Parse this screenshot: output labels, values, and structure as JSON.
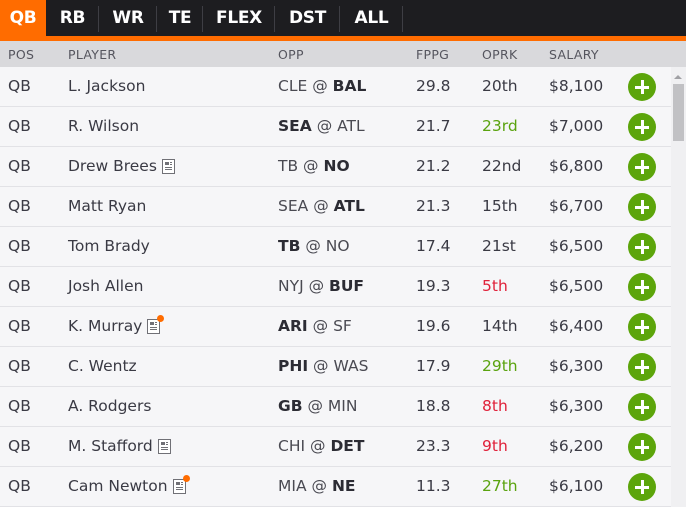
{
  "tabs": [
    {
      "label": "QB",
      "active": true
    },
    {
      "label": "RB",
      "active": false
    },
    {
      "label": "WR",
      "active": false
    },
    {
      "label": "TE",
      "active": false
    },
    {
      "label": "FLEX",
      "active": false
    },
    {
      "label": "DST",
      "active": false
    },
    {
      "label": "ALL",
      "active": false
    }
  ],
  "columns": {
    "pos": "POS",
    "player": "PLAYER",
    "opp": "OPP",
    "fppg": "FPPG",
    "oprk": "OPRK",
    "salary": "SALARY"
  },
  "colors": {
    "accent": "#ff6c00",
    "add_button": "#5ca50b",
    "oprk_good": "#5aa30f",
    "oprk_bad": "#e0213a"
  },
  "players": [
    {
      "pos": "QB",
      "name": "L. Jackson",
      "news": "none",
      "away": "CLE",
      "home": "BAL",
      "team_side": "home",
      "fppg": "29.8",
      "oprk": "20th",
      "oprk_rating": "neutral",
      "salary": "$8,100"
    },
    {
      "pos": "QB",
      "name": "R. Wilson",
      "news": "none",
      "away": "SEA",
      "home": "ATL",
      "team_side": "away",
      "fppg": "21.7",
      "oprk": "23rd",
      "oprk_rating": "good",
      "salary": "$7,000"
    },
    {
      "pos": "QB",
      "name": "Drew Brees",
      "news": "news",
      "away": "TB",
      "home": "NO",
      "team_side": "home",
      "fppg": "21.2",
      "oprk": "22nd",
      "oprk_rating": "neutral",
      "salary": "$6,800"
    },
    {
      "pos": "QB",
      "name": "Matt Ryan",
      "news": "none",
      "away": "SEA",
      "home": "ATL",
      "team_side": "home",
      "fppg": "21.3",
      "oprk": "15th",
      "oprk_rating": "neutral",
      "salary": "$6,700"
    },
    {
      "pos": "QB",
      "name": "Tom Brady",
      "news": "none",
      "away": "TB",
      "home": "NO",
      "team_side": "away",
      "fppg": "17.4",
      "oprk": "21st",
      "oprk_rating": "neutral",
      "salary": "$6,500"
    },
    {
      "pos": "QB",
      "name": "Josh Allen",
      "news": "none",
      "away": "NYJ",
      "home": "BUF",
      "team_side": "home",
      "fppg": "19.3",
      "oprk": "5th",
      "oprk_rating": "bad",
      "salary": "$6,500"
    },
    {
      "pos": "QB",
      "name": "K. Murray",
      "news": "breaking",
      "away": "ARI",
      "home": "SF",
      "team_side": "away",
      "fppg": "19.6",
      "oprk": "14th",
      "oprk_rating": "neutral",
      "salary": "$6,400"
    },
    {
      "pos": "QB",
      "name": "C. Wentz",
      "news": "none",
      "away": "PHI",
      "home": "WAS",
      "team_side": "away",
      "fppg": "17.9",
      "oprk": "29th",
      "oprk_rating": "good",
      "salary": "$6,300"
    },
    {
      "pos": "QB",
      "name": "A. Rodgers",
      "news": "none",
      "away": "GB",
      "home": "MIN",
      "team_side": "away",
      "fppg": "18.8",
      "oprk": "8th",
      "oprk_rating": "bad",
      "salary": "$6,300"
    },
    {
      "pos": "QB",
      "name": "M. Stafford",
      "news": "news",
      "away": "CHI",
      "home": "DET",
      "team_side": "home",
      "fppg": "23.3",
      "oprk": "9th",
      "oprk_rating": "bad",
      "salary": "$6,200"
    },
    {
      "pos": "QB",
      "name": "Cam Newton",
      "news": "breaking",
      "away": "MIA",
      "home": "NE",
      "team_side": "home",
      "fppg": "11.3",
      "oprk": "27th",
      "oprk_rating": "good",
      "salary": "$6,100"
    }
  ],
  "opp_separator": "@",
  "icons": {
    "add": "plus-circle-icon",
    "news": "newspaper-icon",
    "breaking": "orange-dot-badge"
  }
}
